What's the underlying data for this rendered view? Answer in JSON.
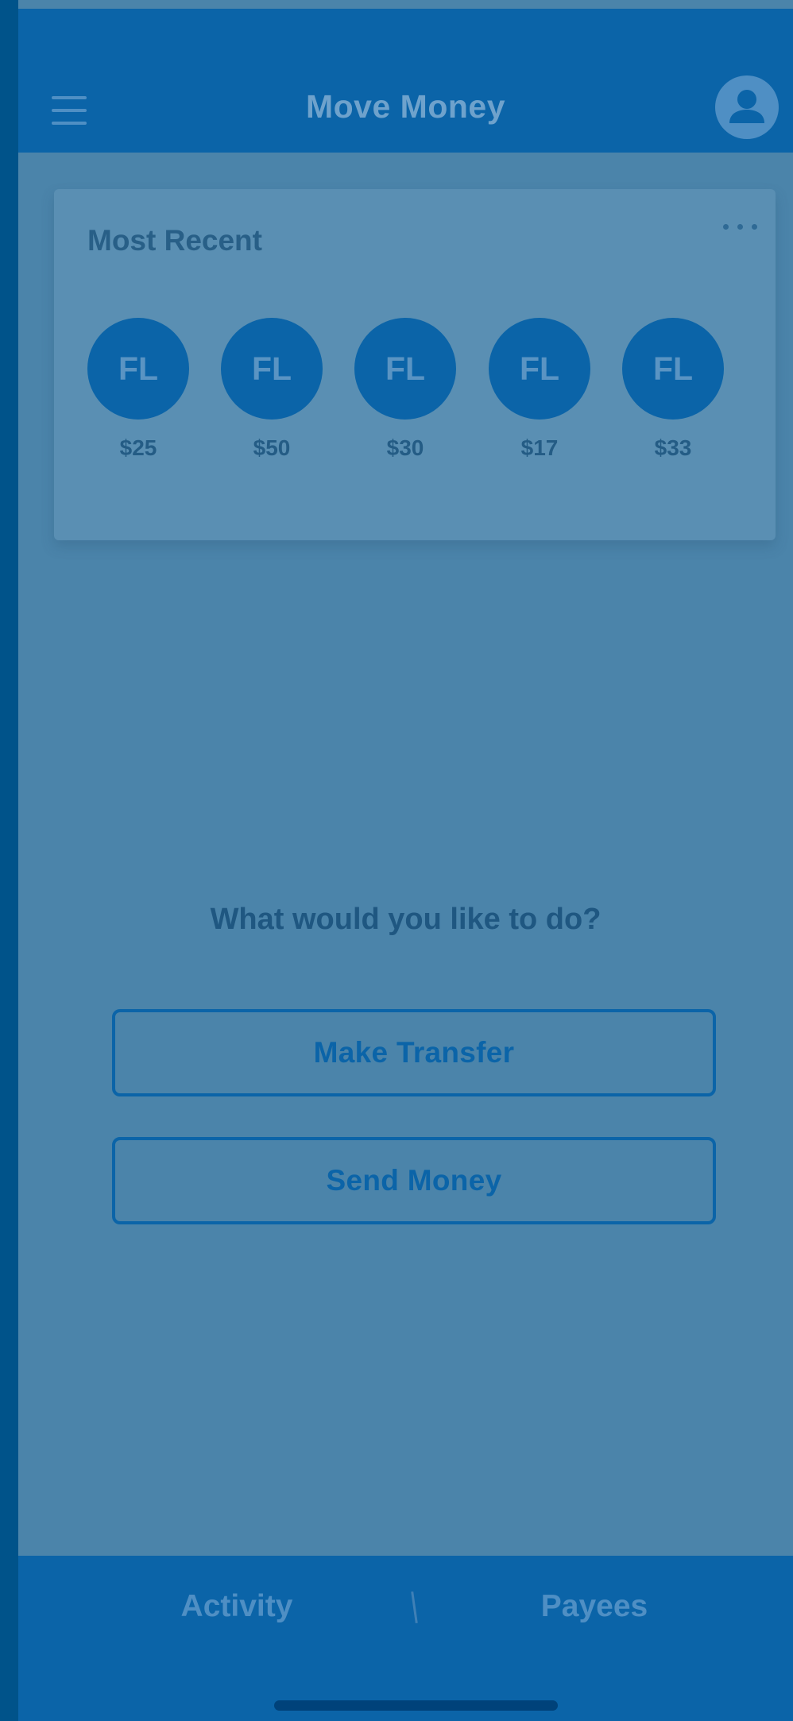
{
  "header": {
    "title": "Move Money",
    "menu_icon": "hamburger-menu-icon",
    "profile_icon": "user-avatar-icon"
  },
  "most_recent": {
    "title": "Most Recent",
    "more_icon": "ellipsis-icon",
    "items": [
      {
        "initials": "FL",
        "amount": "$25"
      },
      {
        "initials": "FL",
        "amount": "$50"
      },
      {
        "initials": "FL",
        "amount": "$30"
      },
      {
        "initials": "FL",
        "amount": "$17"
      },
      {
        "initials": "FL",
        "amount": "$33"
      }
    ]
  },
  "prompt": {
    "question": "What would you like to do?",
    "make_transfer_label": "Make Transfer",
    "send_money_label": "Send Money"
  },
  "tabbar": {
    "activity_label": "Activity",
    "payees_label": "Payees"
  },
  "colors": {
    "primary": "#0b64a8",
    "overlay_background": "#4b84aa",
    "frame": "#00538a"
  }
}
